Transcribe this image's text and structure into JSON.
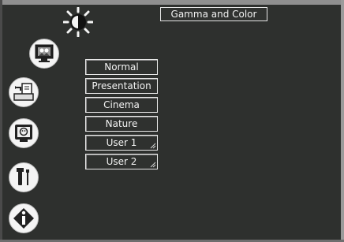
{
  "title": "Gamma and Color",
  "menu_icons": [
    "gamma-icon",
    "picture-icon",
    "setup-icon",
    "smart-icon",
    "advanced-icon",
    "info-icon"
  ],
  "options": [
    {
      "label": "Normal",
      "editable": false
    },
    {
      "label": "Presentation",
      "editable": false
    },
    {
      "label": "Cinema",
      "editable": false
    },
    {
      "label": "Nature",
      "editable": false
    },
    {
      "label": "User 1",
      "editable": true
    },
    {
      "label": "User 2",
      "editable": true
    }
  ],
  "colors": {
    "background": "#2e302e",
    "frame": "#8f8f8f",
    "text": "#f2f2f2",
    "icon_bg": "#f4f4f4"
  }
}
